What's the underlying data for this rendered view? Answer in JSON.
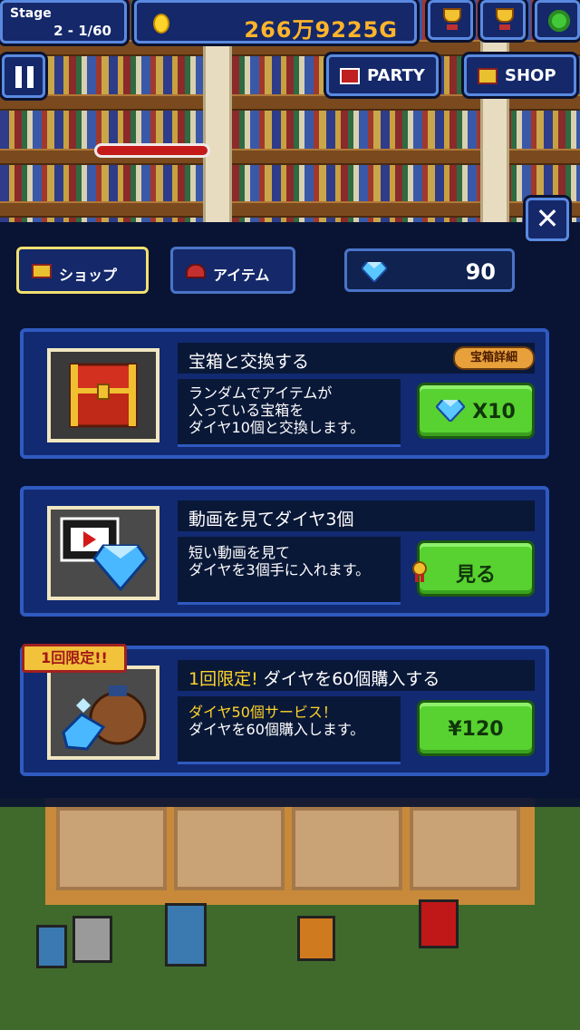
{
  "hud": {
    "stage_label": "Stage",
    "stage_value": "2 - 1/60",
    "gold": "266万9225G",
    "icons": [
      "trophy-quest-icon",
      "trophy-icon",
      "gear-icon"
    ]
  },
  "nav": {
    "party_label": "PARTY",
    "shop_label": "SHOP"
  },
  "tabs": [
    {
      "label": "ショップ",
      "active": true
    },
    {
      "label": "アイテム",
      "active": false
    }
  ],
  "gems": "90",
  "cards": [
    {
      "title": "宝箱と交換する",
      "detail_label": "宝箱詳細",
      "desc": [
        "ランダムでアイテムが",
        "入っている宝箱を",
        "ダイヤ10個と交換します。"
      ],
      "button_label": "X10",
      "image": "treasure-chest"
    },
    {
      "title": "動画を見てダイヤ3個",
      "desc": [
        "短い動画を見て",
        "ダイヤを3個手に入れます。"
      ],
      "button_label": "見る",
      "image": "video-diamond"
    },
    {
      "badge": "1回限定!!",
      "title_highlight": "1回限定!",
      "title": "ダイヤを60個購入する",
      "desc_highlight": "ダイヤ50個サービス！",
      "desc": [
        "ダイヤを60個購入します。"
      ],
      "button_label": "¥120",
      "image": "diamond-bag"
    }
  ],
  "colors": {
    "panel": "#112a72",
    "border": "#2f5ac0",
    "button_green": "#58d230",
    "gold_text": "#ffb42a",
    "highlight_text": "#ffd428"
  }
}
